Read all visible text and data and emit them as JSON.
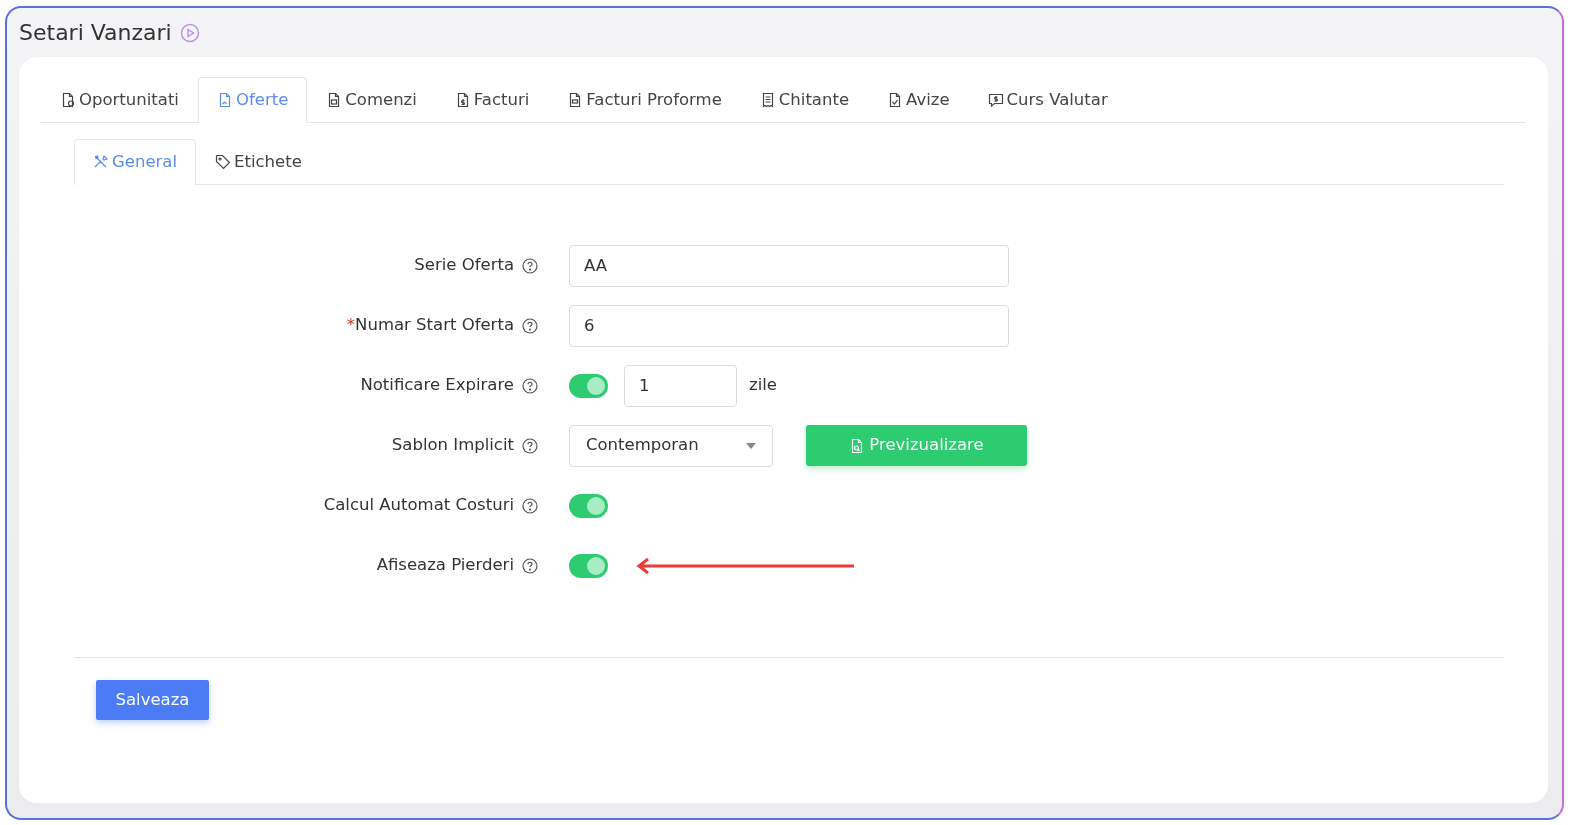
{
  "page_title": "Setari Vanzari",
  "tabs": [
    {
      "label": "Oportunitati",
      "selected": false
    },
    {
      "label": "Oferte",
      "selected": true
    },
    {
      "label": "Comenzi",
      "selected": false
    },
    {
      "label": "Facturi",
      "selected": false
    },
    {
      "label": "Facturi Proforme",
      "selected": false
    },
    {
      "label": "Chitante",
      "selected": false
    },
    {
      "label": "Avize",
      "selected": false
    },
    {
      "label": "Curs Valutar",
      "selected": false
    }
  ],
  "subtabs": [
    {
      "label": "General",
      "selected": true
    },
    {
      "label": "Etichete",
      "selected": false
    }
  ],
  "form": [
    {
      "kind": "text",
      "label": "Serie Oferta",
      "value": "AA"
    },
    {
      "kind": "text",
      "label": "Numar Start Oferta",
      "required_mark": "*",
      "value": "6"
    },
    {
      "kind": "toggle_number",
      "label": "Notificare Expirare",
      "on": true,
      "value": "1",
      "unit": "zile"
    },
    {
      "kind": "select",
      "label": "Sablon Implicit",
      "value": "Contemporan",
      "button": "Previzualizare"
    },
    {
      "kind": "toggle",
      "label": "Calcul Automat Costuri",
      "on": true
    },
    {
      "kind": "toggle",
      "label": "Afiseaza Pierderi",
      "on": true,
      "annotated": true
    }
  ],
  "save_button": "Salveaza"
}
